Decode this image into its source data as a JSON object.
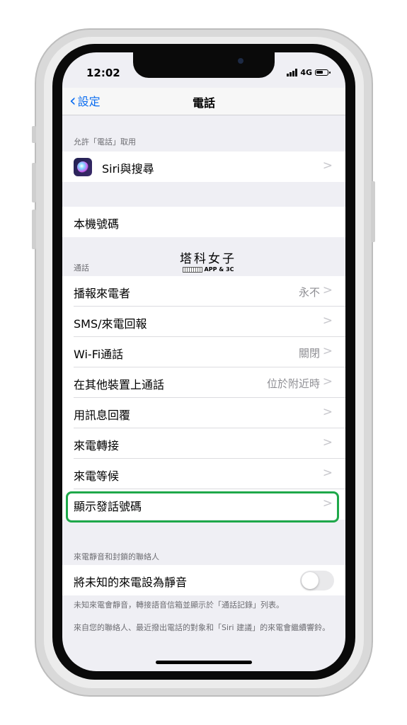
{
  "status_bar": {
    "time": "12:02",
    "network": "4G"
  },
  "nav": {
    "back_label": "設定",
    "title": "電話"
  },
  "section_allow": {
    "header": "允許「電話」取用",
    "siri_label": "Siri與搜尋"
  },
  "my_number_label": "本機號碼",
  "watermark": {
    "title": "塔科女子",
    "subtitle": "APP & 3C"
  },
  "section_calls": {
    "header": "通話",
    "items": [
      {
        "label": "播報來電者",
        "value": "永不"
      },
      {
        "label": "SMS/來電回報",
        "value": ""
      },
      {
        "label": "Wi-Fi通話",
        "value": "關閉"
      },
      {
        "label": "在其他裝置上通話",
        "value": "位於附近時"
      },
      {
        "label": "用訊息回覆",
        "value": ""
      },
      {
        "label": "來電轉接",
        "value": ""
      },
      {
        "label": "來電等候",
        "value": ""
      },
      {
        "label": "顯示發話號碼",
        "value": ""
      }
    ]
  },
  "section_silence": {
    "header": "來電靜音和封鎖的聯絡人",
    "toggle_label": "將未知的來電設為靜音",
    "toggle_on": false,
    "footnote1": "未知來電會靜音，轉接語音信箱並顯示於「通話記錄」列表。",
    "footnote2": "來自您的聯絡人、最近撥出電話的對象和「Siri 建議」的來電會繼續響鈴。"
  },
  "chevron_glyph": ">",
  "colors": {
    "accent": "#0a6cf0",
    "highlight": "#1fa84a",
    "background": "#efeff4"
  }
}
